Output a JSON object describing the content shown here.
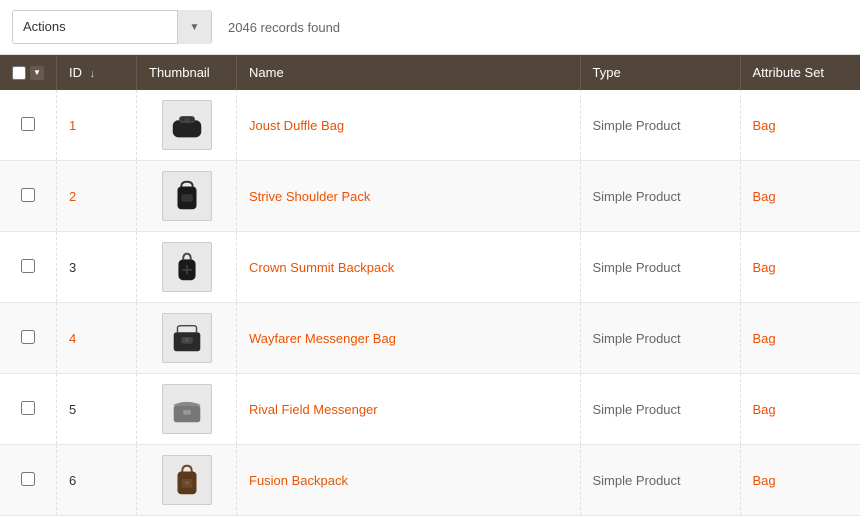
{
  "toolbar": {
    "actions_label": "Actions",
    "records_count": "2046 records found"
  },
  "table": {
    "headers": [
      {
        "key": "checkbox",
        "label": ""
      },
      {
        "key": "id",
        "label": "ID"
      },
      {
        "key": "thumbnail",
        "label": "Thumbnail"
      },
      {
        "key": "name",
        "label": "Name"
      },
      {
        "key": "type",
        "label": "Type"
      },
      {
        "key": "attribute_set",
        "label": "Attribute Set"
      }
    ],
    "rows": [
      {
        "id": "1",
        "name": "Joust Duffle Bag",
        "type": "Simple Product",
        "attribute_set": "Bag",
        "id_is_link": true
      },
      {
        "id": "2",
        "name": "Strive Shoulder Pack",
        "type": "Simple Product",
        "attribute_set": "Bag",
        "id_is_link": true
      },
      {
        "id": "3",
        "name": "Crown Summit Backpack",
        "type": "Simple Product",
        "attribute_set": "Bag",
        "id_is_link": false
      },
      {
        "id": "4",
        "name": "Wayfarer Messenger Bag",
        "type": "Simple Product",
        "attribute_set": "Bag",
        "id_is_link": true
      },
      {
        "id": "5",
        "name": "Rival Field Messenger",
        "type": "Simple Product",
        "attribute_set": "Bag",
        "id_is_link": false
      },
      {
        "id": "6",
        "name": "Fusion Backpack",
        "type": "Simple Product",
        "attribute_set": "Bag",
        "id_is_link": false
      }
    ]
  },
  "icons": {
    "dropdown_arrow": "▼",
    "sort_desc": "↓"
  }
}
